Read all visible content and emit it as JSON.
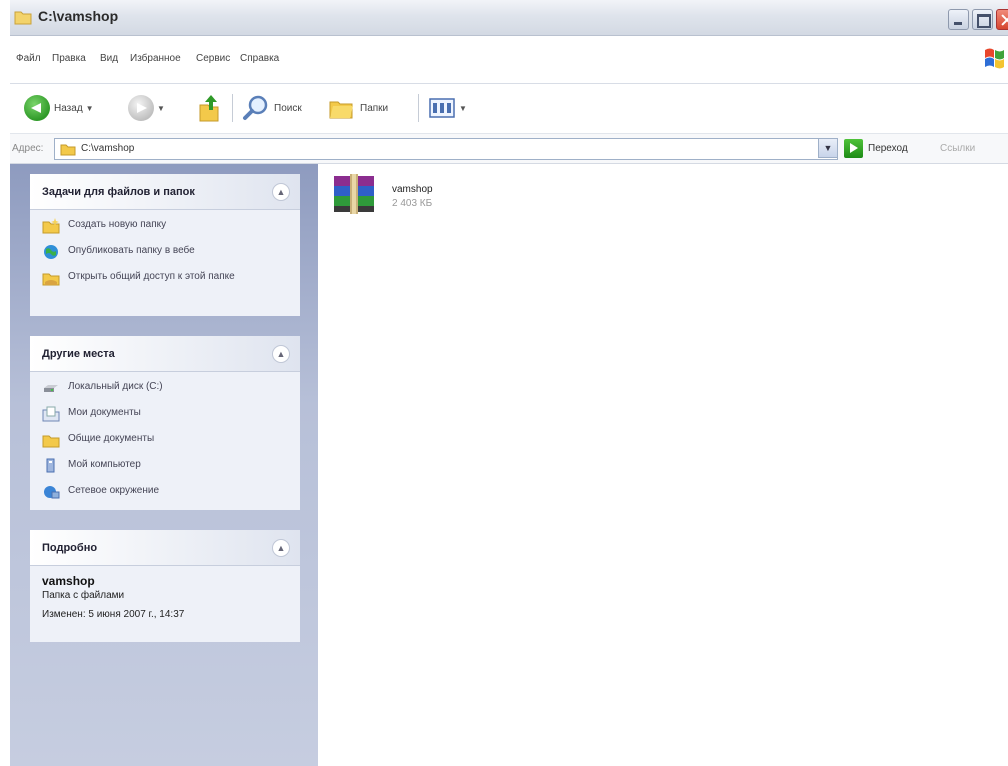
{
  "window": {
    "title": "C:\\vamshop"
  },
  "menu": {
    "items": [
      "Файл",
      "Правка",
      "Вид",
      "Избранное",
      "Сервис",
      "Справка"
    ]
  },
  "toolbar": {
    "back_label": "Назад",
    "search_label": "Поиск",
    "folders_label": "Папки"
  },
  "address": {
    "label": "Адрес:",
    "value": "C:\\vamshop",
    "go_label": "Переход",
    "links_label": "Ссылки"
  },
  "tasks_panel": {
    "title": "Задачи для файлов и папок",
    "items": [
      {
        "label": "Создать новую папку",
        "icon": "new-folder-icon"
      },
      {
        "label": "Опубликовать папку в вебе",
        "icon": "globe-icon"
      },
      {
        "label": "Открыть общий доступ к этой папке",
        "icon": "share-folder-icon"
      }
    ]
  },
  "places_panel": {
    "title": "Другие места",
    "items": [
      {
        "label": "Локальный диск (C:)",
        "icon": "drive-icon"
      },
      {
        "label": "Мои документы",
        "icon": "my-documents-icon"
      },
      {
        "label": "Общие документы",
        "icon": "shared-documents-icon"
      },
      {
        "label": "Мой компьютер",
        "icon": "computer-icon"
      },
      {
        "label": "Сетевое окружение",
        "icon": "network-icon"
      }
    ]
  },
  "details_panel": {
    "title": "Подробно",
    "name": "vamshop",
    "type": "Папка с файлами",
    "modified": "Изменен: 5 июня 2007 г., 14:37"
  },
  "files": [
    {
      "name": "vamshop",
      "size": "2 403 КБ",
      "icon": "winrar-archive-icon"
    }
  ],
  "colors": {
    "pane_top": "#8e9bbf",
    "pane_bottom": "#c6cde0",
    "panel_bg": "#eef1f8"
  }
}
